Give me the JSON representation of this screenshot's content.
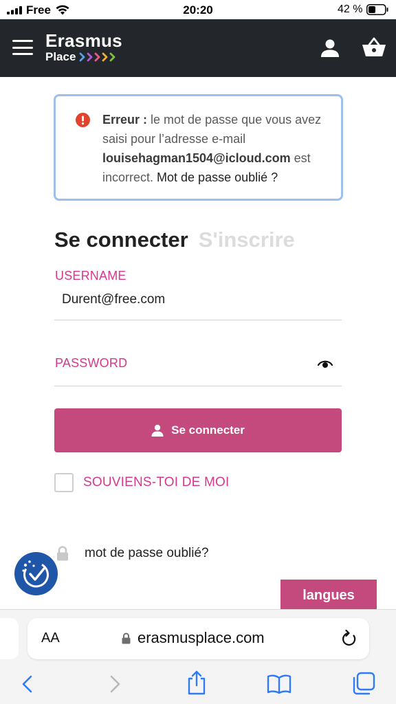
{
  "status_bar": {
    "carrier": "Free",
    "time": "20:20",
    "battery_percent": "42 %"
  },
  "header": {
    "logo_top": "Erasmus",
    "logo_bottom": "Place",
    "logo_arrow_colors": [
      "#5aa0e6",
      "#b05ad6",
      "#e85a8c",
      "#f0b030",
      "#7fc040"
    ],
    "menu_icon": "hamburger-menu-icon",
    "account_icon": "user-icon",
    "cart_icon": "basket-icon"
  },
  "alert": {
    "prefix": "Erreur :",
    "message_part1": " le mot de passe que vous avez saisi pour l’adresse e-mail ",
    "email": "louisehagman1504@icloud.com",
    "message_part2": " est incorrect. ",
    "link_text": "Mot de passe oublié ?",
    "icon": "error-icon",
    "icon_color": "#e0442f",
    "border_color": "#9cc0ec"
  },
  "tabs": {
    "login": "Se connecter",
    "register": "S'inscrire"
  },
  "form": {
    "username_label": "USERNAME",
    "username_value": "Durent@free.com",
    "password_label": "PASSWORD",
    "password_value": "",
    "show_password_icon": "eye-icon",
    "submit_label": "Se connecter",
    "remember_label": "SOUVIENS-TOI DE MOI",
    "remember_checked": false,
    "forgot_label": "mot de passe oublié?",
    "label_color": "#d9378c",
    "button_color": "#c44a7e"
  },
  "language_button": {
    "label": "langues"
  },
  "browser": {
    "text_size_label": "AA",
    "url": "erasmusplace.com",
    "nav_icons": [
      "back-icon",
      "forward-icon",
      "share-icon",
      "bookmarks-icon",
      "tabs-icon"
    ]
  }
}
